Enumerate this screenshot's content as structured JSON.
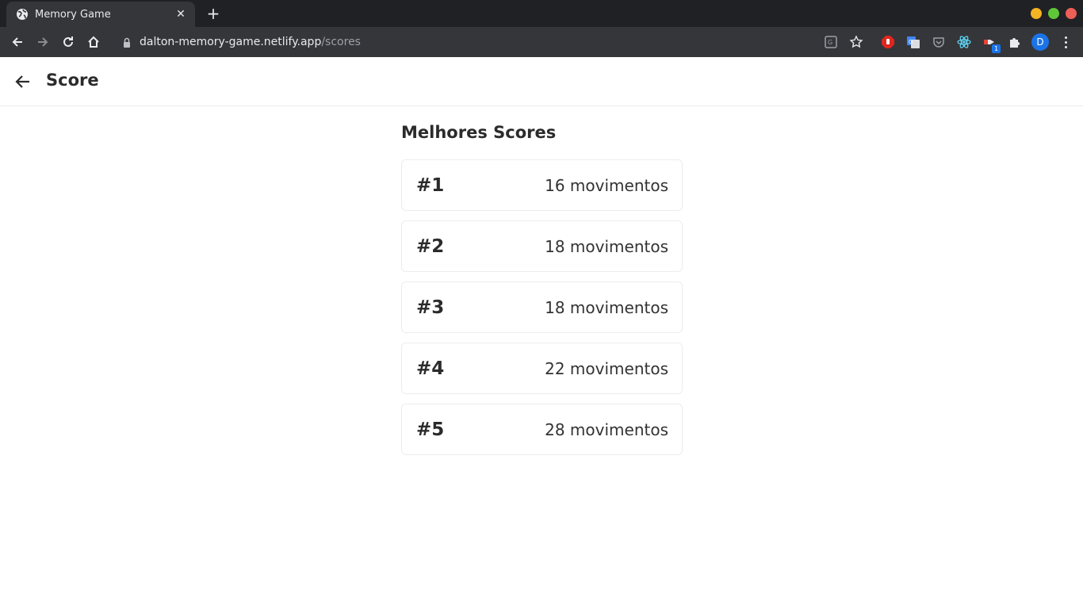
{
  "browser": {
    "tab_title": "Memory Game",
    "url_host": "dalton-memory-game.netlify.app",
    "url_path": "/scores",
    "profile_initial": "D",
    "extension_badge": "1",
    "colors": {
      "close": "#ed5f57",
      "minimize": "#f5b324",
      "maximize": "#5fc638"
    }
  },
  "header": {
    "title": "Score"
  },
  "scores": {
    "heading": "Melhores Scores",
    "items": [
      {
        "rank": "#1",
        "moves": "16 movimentos"
      },
      {
        "rank": "#2",
        "moves": "18 movimentos"
      },
      {
        "rank": "#3",
        "moves": "18 movimentos"
      },
      {
        "rank": "#4",
        "moves": "22 movimentos"
      },
      {
        "rank": "#5",
        "moves": "28 movimentos"
      }
    ]
  }
}
